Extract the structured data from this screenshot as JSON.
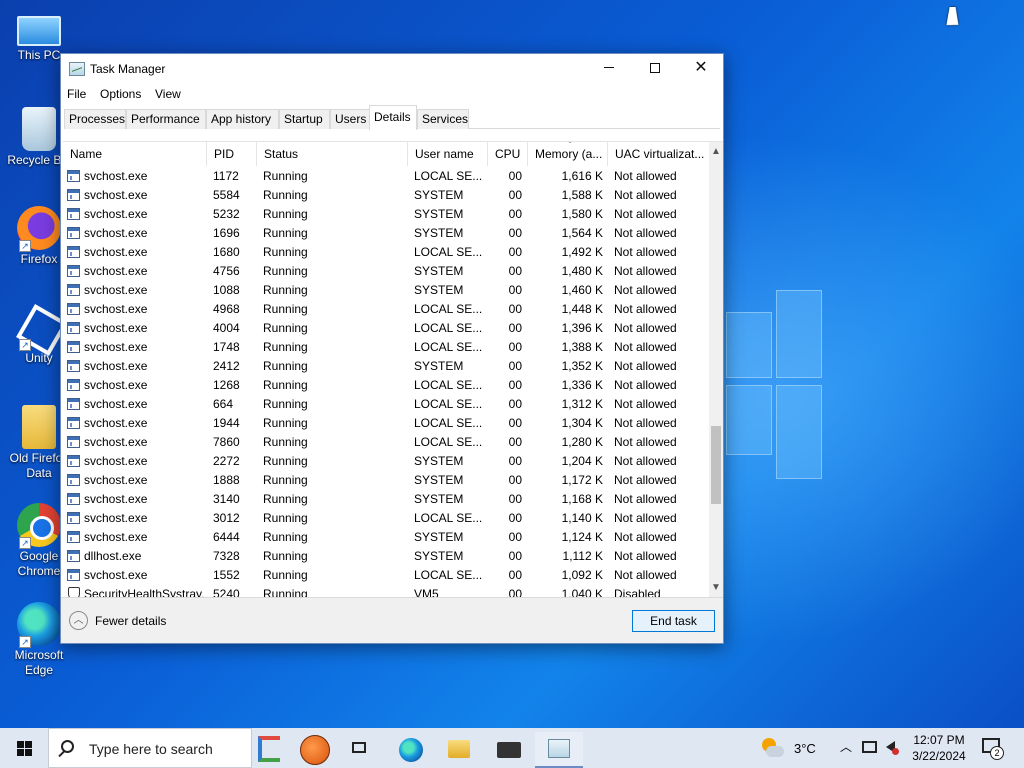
{
  "desktop": {
    "icons": [
      {
        "label": "This PC",
        "icon": "this-pc-icon"
      },
      {
        "label": "Recycle Bin",
        "icon": "recycle-bin-icon"
      },
      {
        "label": "Firefox",
        "icon": "firefox-icon"
      },
      {
        "label": "Unity",
        "icon": "unity-icon"
      },
      {
        "label": "Old Firefox Data",
        "icon": "folder-icon"
      },
      {
        "label": "Google Chrome",
        "icon": "chrome-icon"
      },
      {
        "label": "Microsoft Edge",
        "icon": "edge-icon"
      }
    ]
  },
  "window": {
    "title": "Task Manager",
    "menu": [
      "File",
      "Options",
      "View"
    ],
    "tabs": [
      "Processes",
      "Performance",
      "App history",
      "Startup",
      "Users",
      "Details",
      "Services"
    ],
    "active_tab": "Details",
    "columns": [
      "Name",
      "PID",
      "Status",
      "User name",
      "CPU",
      "Memory (a...",
      "UAC virtualizat..."
    ],
    "rows": [
      {
        "name": "svchost.exe",
        "pid": "1172",
        "status": "Running",
        "user": "LOCAL SE...",
        "cpu": "00",
        "mem": "1,616 K",
        "uac": "Not allowed"
      },
      {
        "name": "svchost.exe",
        "pid": "5584",
        "status": "Running",
        "user": "SYSTEM",
        "cpu": "00",
        "mem": "1,588 K",
        "uac": "Not allowed"
      },
      {
        "name": "svchost.exe",
        "pid": "5232",
        "status": "Running",
        "user": "SYSTEM",
        "cpu": "00",
        "mem": "1,580 K",
        "uac": "Not allowed"
      },
      {
        "name": "svchost.exe",
        "pid": "1696",
        "status": "Running",
        "user": "SYSTEM",
        "cpu": "00",
        "mem": "1,564 K",
        "uac": "Not allowed"
      },
      {
        "name": "svchost.exe",
        "pid": "1680",
        "status": "Running",
        "user": "LOCAL SE...",
        "cpu": "00",
        "mem": "1,492 K",
        "uac": "Not allowed"
      },
      {
        "name": "svchost.exe",
        "pid": "4756",
        "status": "Running",
        "user": "SYSTEM",
        "cpu": "00",
        "mem": "1,480 K",
        "uac": "Not allowed"
      },
      {
        "name": "svchost.exe",
        "pid": "1088",
        "status": "Running",
        "user": "SYSTEM",
        "cpu": "00",
        "mem": "1,460 K",
        "uac": "Not allowed"
      },
      {
        "name": "svchost.exe",
        "pid": "4968",
        "status": "Running",
        "user": "LOCAL SE...",
        "cpu": "00",
        "mem": "1,448 K",
        "uac": "Not allowed"
      },
      {
        "name": "svchost.exe",
        "pid": "4004",
        "status": "Running",
        "user": "LOCAL SE...",
        "cpu": "00",
        "mem": "1,396 K",
        "uac": "Not allowed"
      },
      {
        "name": "svchost.exe",
        "pid": "1748",
        "status": "Running",
        "user": "LOCAL SE...",
        "cpu": "00",
        "mem": "1,388 K",
        "uac": "Not allowed"
      },
      {
        "name": "svchost.exe",
        "pid": "2412",
        "status": "Running",
        "user": "SYSTEM",
        "cpu": "00",
        "mem": "1,352 K",
        "uac": "Not allowed"
      },
      {
        "name": "svchost.exe",
        "pid": "1268",
        "status": "Running",
        "user": "LOCAL SE...",
        "cpu": "00",
        "mem": "1,336 K",
        "uac": "Not allowed"
      },
      {
        "name": "svchost.exe",
        "pid": "664",
        "status": "Running",
        "user": "LOCAL SE...",
        "cpu": "00",
        "mem": "1,312 K",
        "uac": "Not allowed"
      },
      {
        "name": "svchost.exe",
        "pid": "1944",
        "status": "Running",
        "user": "LOCAL SE...",
        "cpu": "00",
        "mem": "1,304 K",
        "uac": "Not allowed"
      },
      {
        "name": "svchost.exe",
        "pid": "7860",
        "status": "Running",
        "user": "LOCAL SE...",
        "cpu": "00",
        "mem": "1,280 K",
        "uac": "Not allowed"
      },
      {
        "name": "svchost.exe",
        "pid": "2272",
        "status": "Running",
        "user": "SYSTEM",
        "cpu": "00",
        "mem": "1,204 K",
        "uac": "Not allowed"
      },
      {
        "name": "svchost.exe",
        "pid": "1888",
        "status": "Running",
        "user": "SYSTEM",
        "cpu": "00",
        "mem": "1,172 K",
        "uac": "Not allowed"
      },
      {
        "name": "svchost.exe",
        "pid": "3140",
        "status": "Running",
        "user": "SYSTEM",
        "cpu": "00",
        "mem": "1,168 K",
        "uac": "Not allowed"
      },
      {
        "name": "svchost.exe",
        "pid": "3012",
        "status": "Running",
        "user": "LOCAL SE...",
        "cpu": "00",
        "mem": "1,140 K",
        "uac": "Not allowed"
      },
      {
        "name": "svchost.exe",
        "pid": "6444",
        "status": "Running",
        "user": "SYSTEM",
        "cpu": "00",
        "mem": "1,124 K",
        "uac": "Not allowed"
      },
      {
        "name": "dllhost.exe",
        "pid": "7328",
        "status": "Running",
        "user": "SYSTEM",
        "cpu": "00",
        "mem": "1,112 K",
        "uac": "Not allowed"
      },
      {
        "name": "svchost.exe",
        "pid": "1552",
        "status": "Running",
        "user": "LOCAL SE...",
        "cpu": "00",
        "mem": "1,092 K",
        "uac": "Not allowed"
      },
      {
        "name": "SecurityHealthSystray.exe",
        "pid": "5240",
        "status": "Running",
        "user": "VM5",
        "cpu": "00",
        "mem": "1,040 K",
        "uac": "Disabled",
        "icon": "shield-icon"
      }
    ],
    "footer": {
      "fewer_details": "Fewer details",
      "end_task": "End task"
    }
  },
  "taskbar": {
    "search_placeholder": "Type here to search",
    "weather_temp": "3°C",
    "clock_time": "12:07 PM",
    "clock_date": "3/22/2024",
    "notification_count": "2"
  }
}
